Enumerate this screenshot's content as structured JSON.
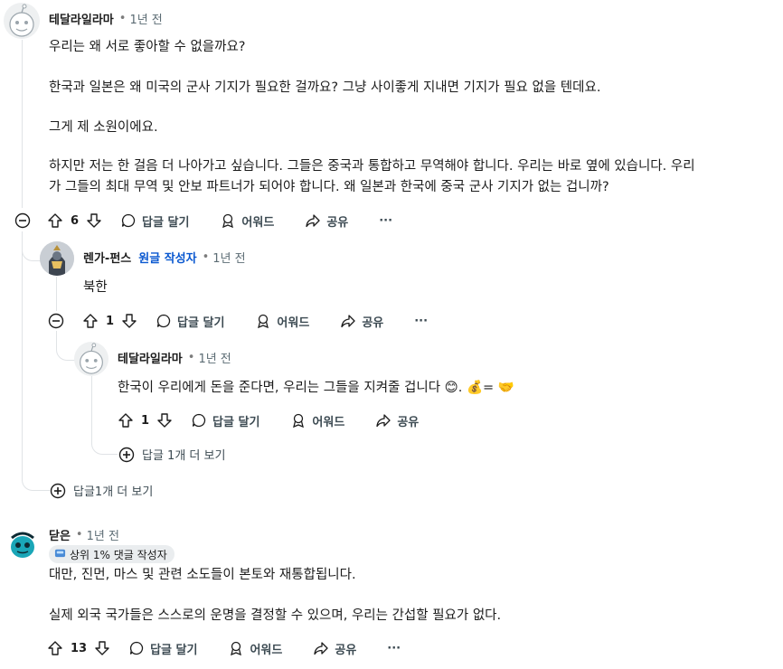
{
  "comments": [
    {
      "author": "테달라일라마",
      "time": "1년 전",
      "paragraphs": [
        "우리는 왜 서로 좋아할 수 없을까요?",
        "한국과 일본은 왜 미국의 군사 기지가 필요한 걸까요? 그냥 사이좋게 지내면 기지가 필요 없을 텐데요.",
        "그게 제 소원이에요.",
        "하지만 저는 한 걸음 더 나아가고 싶습니다. 그들은 중국과 통합하고 무역해야 합니다. 우리는 바로 옆에 있습니다. 우리",
        "가 그들의 최대 무역 및 안보 파트너가 되어야 합니다. 왜 일본과 한국에 중국 군사 기지가 없는 겁니까?"
      ],
      "votes": "6"
    },
    {
      "author": "렌가-펀스",
      "op_badge": "원글 작성자",
      "time": "1년 전",
      "paragraphs": [
        "북한"
      ],
      "votes": "1"
    },
    {
      "author": "테달라일라마",
      "time": "1년 전",
      "text_prefix": "한국이 우리에게 돈을 준다면, 우리는 그들을 지켜줄 겁니다 ",
      "emoji_smile": "😊",
      "text_mid": ". ",
      "emoji_money": "💰",
      "text_eq": "= ",
      "emoji_hands": "🤝",
      "votes": "1"
    },
    {
      "author": "닫은",
      "time": "1년 전",
      "flair": "상위 1% 댓글 작성자",
      "paragraphs": [
        "대만, 진먼, 마스 및 관련 소도들이 본토와 재통합됩니다.",
        "실제 외국 국가들은 스스로의 운명을 결정할 수 있으며, 우리는 간섭할 필요가 없다."
      ],
      "votes": "13"
    }
  ],
  "actions": {
    "reply": "답글 달기",
    "award": "어워드",
    "share": "공유",
    "more": "···"
  },
  "more_replies": {
    "nested": "답글 1개 더 보기",
    "top": "답글1개 더 보기"
  },
  "separator_dot": "•",
  "icons": [
    "collapse-icon",
    "upvote-icon",
    "downvote-icon",
    "comment-icon",
    "award-icon",
    "share-icon",
    "expand-icon",
    "flair-icon"
  ],
  "colors": {
    "op": "#0a58d0",
    "thread": "#e0e3e6",
    "text": "#1c1c1c",
    "muted": "#5c6c74"
  }
}
